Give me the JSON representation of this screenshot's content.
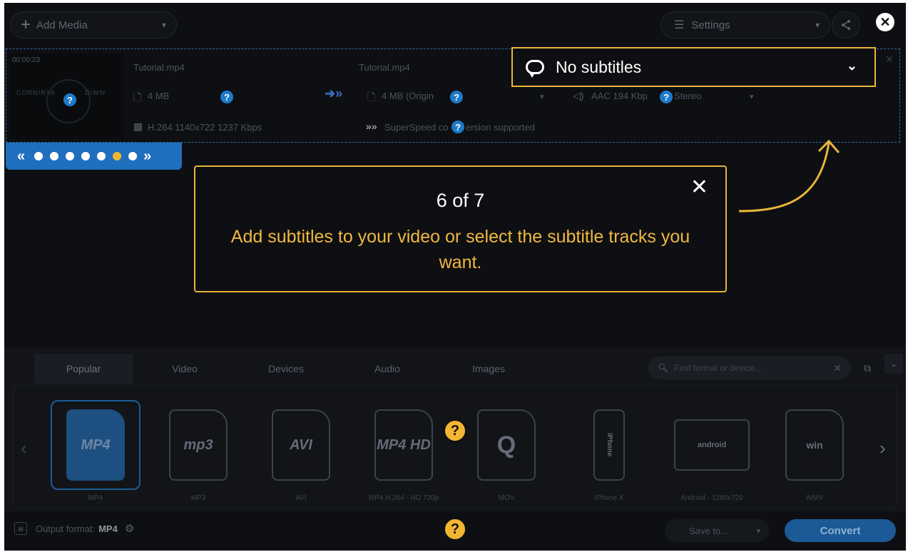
{
  "topbar": {
    "add_media_label": "Add Media",
    "settings_label": "Settings"
  },
  "file": {
    "duration": "00:00:23",
    "source_name": "Tutorial.mp4",
    "source_size": "4 MB",
    "source_codec": "H.264 1140x722 1237 Kbps",
    "output_name": "Tutorial.mp4",
    "output_size": "4 MB (Origin",
    "audio": "AAC 194 Kbp",
    "audio_channels": "Stereo",
    "superspeed_a": "SuperSpeed co",
    "superspeed_b": "ersion supported"
  },
  "subtitles": {
    "selected": "No subtitles"
  },
  "tour": {
    "counter": "6 of 7",
    "message": "Add subtitles to your video or select the subtitle tracks you want.",
    "total_steps": 7,
    "current_step": 6,
    "active_color": "#f2b632"
  },
  "format_panel": {
    "tabs": [
      "Popular",
      "Video",
      "Devices",
      "Audio",
      "Images"
    ],
    "active_tab": "Popular",
    "search_placeholder": "Find format or device...",
    "formats": [
      {
        "label": "MP4",
        "icon_text": "MP4"
      },
      {
        "label": "MP3",
        "icon_text": "mp3"
      },
      {
        "label": "AVI",
        "icon_text": "AVI"
      },
      {
        "label": "MP4 H.264 - HD 720p",
        "icon_text": "MP4 HD"
      },
      {
        "label": "MOV",
        "icon_text": "Q"
      },
      {
        "label": "iPhone X",
        "icon_text": "iPhone"
      },
      {
        "label": "Android - 1280x720",
        "icon_text": "android"
      },
      {
        "label": "WMV",
        "icon_text": "win"
      }
    ]
  },
  "bottom": {
    "output_format_label": "Output format:",
    "output_format_value": "MP4",
    "save_to_label": "Save to...",
    "convert_label": "Convert"
  },
  "colors": {
    "accent": "#f2b632",
    "brand_blue": "#1f6fbf",
    "background": "#0e0f12"
  }
}
